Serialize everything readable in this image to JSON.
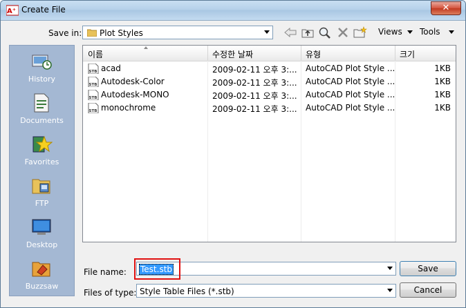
{
  "window": {
    "title": "Create File",
    "app_icon_text": "A⁺"
  },
  "savein": {
    "label": "Save in:",
    "value": "Plot Styles"
  },
  "toolbar": {
    "views_label": "Views",
    "tools_label": "Tools"
  },
  "places": [
    {
      "label": "History",
      "icon": "history-icon"
    },
    {
      "label": "Documents",
      "icon": "documents-icon"
    },
    {
      "label": "Favorites",
      "icon": "favorites-icon"
    },
    {
      "label": "FTP",
      "icon": "ftp-icon"
    },
    {
      "label": "Desktop",
      "icon": "desktop-icon"
    },
    {
      "label": "Buzzsaw",
      "icon": "buzzsaw-icon"
    }
  ],
  "file_list": {
    "columns": [
      "이름",
      "수정한 날짜",
      "유형",
      "크기"
    ],
    "rows": [
      {
        "name": "acad",
        "date": "2009-02-11 오후 3:...",
        "type": "AutoCAD Plot Style ...",
        "size": "1KB"
      },
      {
        "name": "Autodesk-Color",
        "date": "2009-02-11 오후 3:...",
        "type": "AutoCAD Plot Style ...",
        "size": "1KB"
      },
      {
        "name": "Autodesk-MONO",
        "date": "2009-02-11 오후 3:...",
        "type": "AutoCAD Plot Style ...",
        "size": "1KB"
      },
      {
        "name": "monochrome",
        "date": "2009-02-11 오후 3:...",
        "type": "AutoCAD Plot Style ...",
        "size": "1KB"
      }
    ],
    "file_icon_text": "STB"
  },
  "filename": {
    "label": "File name:",
    "value": "Test.stb"
  },
  "filetype": {
    "label": "Files of type:",
    "value": "Style Table Files (*.stb)"
  },
  "buttons": {
    "save": "Save",
    "cancel": "Cancel"
  },
  "colors": {
    "highlight": "#e01010",
    "selection": "#3399ff",
    "places_bg": "#a4b8d3"
  }
}
